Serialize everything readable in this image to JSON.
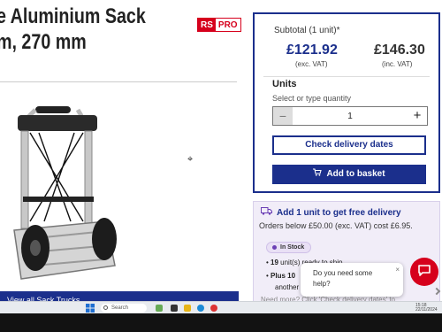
{
  "product": {
    "title_line1": "e Aluminium Sack",
    "title_line2": "m, 270 mm",
    "brand_rs": "RS",
    "brand_pro": "PRO",
    "view_all": "View all Sack Trucks"
  },
  "pricing": {
    "subtotal_label": "Subtotal (1 unit)*",
    "price_ex_vat": "£121.92",
    "label_ex_vat": "(exc. VAT)",
    "price_inc_vat": "£146.30",
    "label_inc_vat": "(inc. VAT)"
  },
  "quantity": {
    "label": "Units",
    "hint": "Select or type quantity",
    "value": "1",
    "minus": "−",
    "plus": "+"
  },
  "actions": {
    "check_delivery": "Check delivery dates",
    "add_to_basket": "Add to basket"
  },
  "promo": {
    "title": "Add 1 unit to get free delivery",
    "subtitle": "Orders below £50.00 (exc. VAT) cost £6.95.",
    "stock_badge": "In Stock",
    "line1_bold": "19",
    "line1_rest": " unit(s) ready to ship",
    "line2_bold": "Plus 10",
    "line3": "another",
    "line4": "Need more? Click 'Check delivery dates' to"
  },
  "help": {
    "text": "Do you need some help?",
    "close": "×"
  },
  "taskbar": {
    "search_placeholder": "Search",
    "tray": "15:18 22/11/2024"
  },
  "colors": {
    "brand_blue": "#1b2f8c",
    "rs_red": "#d6001c",
    "promo_bg": "#f1edf8"
  }
}
